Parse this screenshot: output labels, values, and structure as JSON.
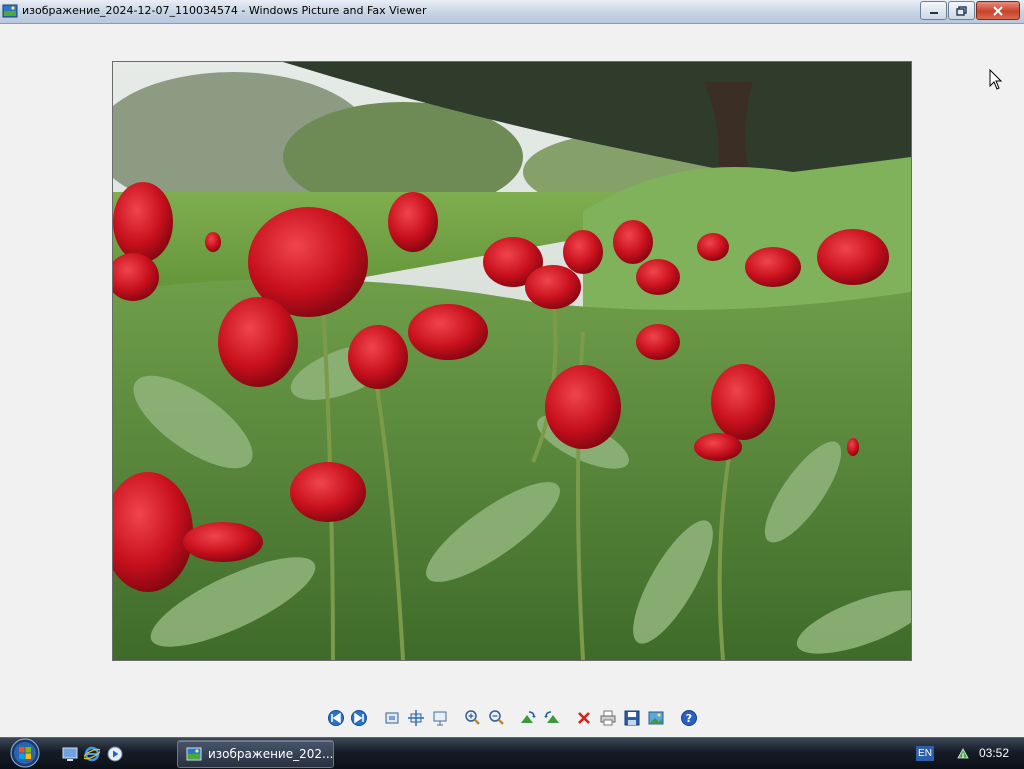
{
  "window": {
    "title": "изображение_2024-12-07_110034574 - Windows Picture and Fax Viewer",
    "controls": [
      "minimize-icon",
      "restore-icon",
      "close-icon"
    ]
  },
  "viewer": {
    "image_description_icon": "photo-red-tulips",
    "toolbar": [
      {
        "name": "previous-image-button",
        "icon": "previous-icon"
      },
      {
        "name": "next-image-button",
        "icon": "next-icon"
      },
      {
        "name": "best-fit-button",
        "icon": "best-fit-icon"
      },
      {
        "name": "actual-size-button",
        "icon": "actual-size-icon"
      },
      {
        "name": "slideshow-button",
        "icon": "slideshow-icon"
      },
      {
        "name": "zoom-in-button",
        "icon": "zoom-in-icon"
      },
      {
        "name": "zoom-out-button",
        "icon": "zoom-out-icon"
      },
      {
        "name": "rotate-clockwise-button",
        "icon": "rotate-clockwise-icon"
      },
      {
        "name": "rotate-counterclockwise-button",
        "icon": "rotate-counterclockwise-icon"
      },
      {
        "name": "delete-button",
        "icon": "delete-icon"
      },
      {
        "name": "print-button",
        "icon": "print-icon"
      },
      {
        "name": "save-button",
        "icon": "save-icon"
      },
      {
        "name": "open-editor-button",
        "icon": "edit-image-icon"
      },
      {
        "name": "help-button",
        "icon": "help-icon"
      }
    ]
  },
  "taskbar": {
    "task_label": "изображение_202...",
    "language": "EN",
    "clock": "03:52",
    "quick_launch": [
      "show-desktop-icon",
      "internet-explorer-icon",
      "media-player-icon"
    ]
  }
}
